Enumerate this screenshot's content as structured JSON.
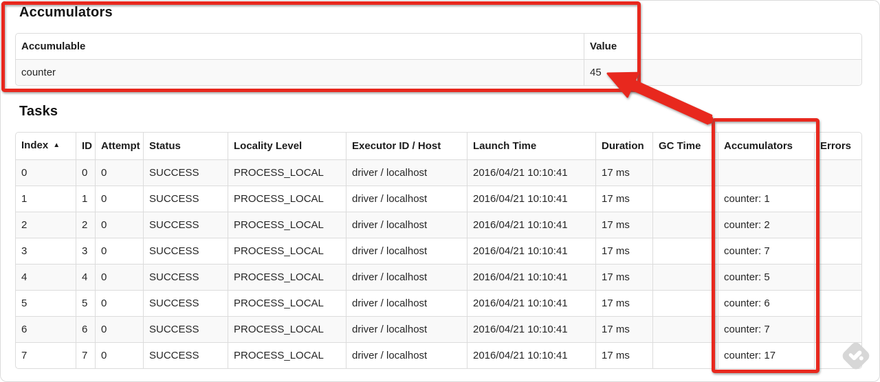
{
  "annotations": {
    "color": "#e8281e",
    "note": "red boxes highlight accumulator total and per-task accumulator column; arrow points from Accumulators column to total value 45"
  },
  "watermark_color": "#d7d7d7",
  "accumulators_section": {
    "heading": "Accumulators",
    "table": {
      "headers": [
        "Accumulable",
        "Value"
      ],
      "rows": [
        [
          "counter",
          "45"
        ]
      ]
    }
  },
  "tasks_section": {
    "heading": "Tasks",
    "table": {
      "sort_indicator": "▲",
      "headers": [
        "Index",
        "ID",
        "Attempt",
        "Status",
        "Locality Level",
        "Executor ID / Host",
        "Launch Time",
        "Duration",
        "GC Time",
        "Accumulators",
        "Errors"
      ],
      "rows": [
        [
          "0",
          "0",
          "0",
          "SUCCESS",
          "PROCESS_LOCAL",
          "driver / localhost",
          "2016/04/21 10:10:41",
          "17 ms",
          "",
          "",
          ""
        ],
        [
          "1",
          "1",
          "0",
          "SUCCESS",
          "PROCESS_LOCAL",
          "driver / localhost",
          "2016/04/21 10:10:41",
          "17 ms",
          "",
          "counter: 1",
          ""
        ],
        [
          "2",
          "2",
          "0",
          "SUCCESS",
          "PROCESS_LOCAL",
          "driver / localhost",
          "2016/04/21 10:10:41",
          "17 ms",
          "",
          "counter: 2",
          ""
        ],
        [
          "3",
          "3",
          "0",
          "SUCCESS",
          "PROCESS_LOCAL",
          "driver / localhost",
          "2016/04/21 10:10:41",
          "17 ms",
          "",
          "counter: 7",
          ""
        ],
        [
          "4",
          "4",
          "0",
          "SUCCESS",
          "PROCESS_LOCAL",
          "driver / localhost",
          "2016/04/21 10:10:41",
          "17 ms",
          "",
          "counter: 5",
          ""
        ],
        [
          "5",
          "5",
          "0",
          "SUCCESS",
          "PROCESS_LOCAL",
          "driver / localhost",
          "2016/04/21 10:10:41",
          "17 ms",
          "",
          "counter: 6",
          ""
        ],
        [
          "6",
          "6",
          "0",
          "SUCCESS",
          "PROCESS_LOCAL",
          "driver / localhost",
          "2016/04/21 10:10:41",
          "17 ms",
          "",
          "counter: 7",
          ""
        ],
        [
          "7",
          "7",
          "0",
          "SUCCESS",
          "PROCESS_LOCAL",
          "driver / localhost",
          "2016/04/21 10:10:41",
          "17 ms",
          "",
          "counter: 17",
          ""
        ]
      ]
    }
  }
}
